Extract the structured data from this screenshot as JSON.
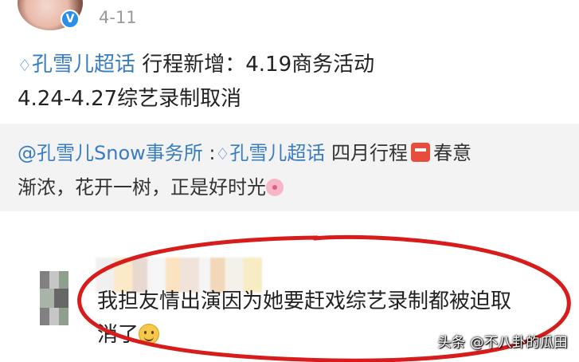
{
  "header": {
    "verified_badge": "V",
    "date": "4-11"
  },
  "post": {
    "topic_icon": "diamond-icon",
    "topic": "孔雪儿超话",
    "line1_text": " 行程新增：4.19商务活动",
    "line2_text": "4.24-4.27综艺录制取消"
  },
  "quote": {
    "author": "@孔雪儿Snow事务所",
    "separator": " :",
    "topic": "孔雪儿超话",
    "text_a": " 四月行程",
    "text_b": "春意",
    "text_c": "渐浓，花开一树，正是好时光"
  },
  "comment": {
    "text": "我担友情出演因为她要赶戏综艺录制都被迫取消了",
    "emoji": "smile-emoji"
  },
  "watermark": "头条 @不八卦的瓜田",
  "colors": {
    "topic_blue": "#3a7cc2",
    "highlight_red": "#d81b1b",
    "quote_bg": "#f3f3f3"
  }
}
